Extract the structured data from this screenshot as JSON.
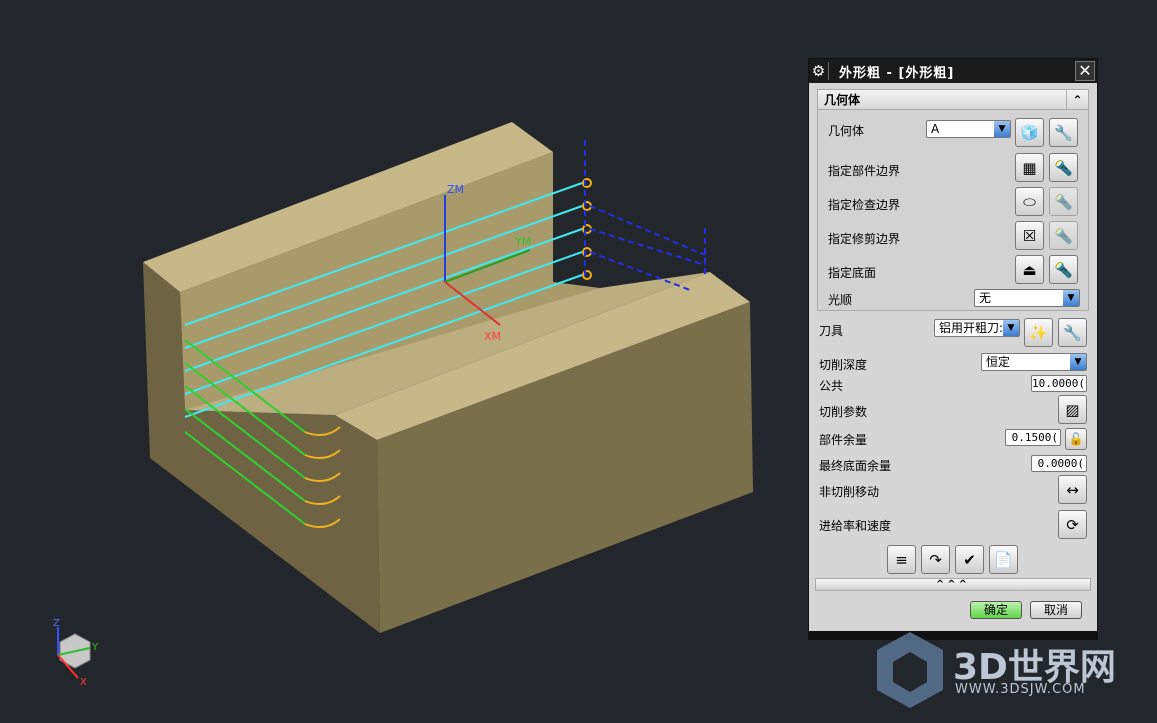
{
  "viewport": {
    "axis_labels": {
      "zm": "ZM",
      "ym": "YM",
      "xm": "XM"
    },
    "triad": {
      "z": "Z",
      "y": "Y",
      "x": "X"
    }
  },
  "dialog": {
    "title": "外形粗 - [外形粗]",
    "section_title": "几何体",
    "geometry": {
      "label": "几何体",
      "value": "A"
    },
    "part_boundary": "指定部件边界",
    "check_boundary": "指定检查边界",
    "trim_boundary": "指定修剪边界",
    "floor": "指定底面",
    "smooth": {
      "label": "光顺",
      "value": "无"
    },
    "tool": {
      "label": "刀具",
      "value": "铝用开粗刀:"
    },
    "cut_depth": {
      "label": "切削深度",
      "value": "恒定"
    },
    "common": {
      "label": "公共",
      "value": "10.0000("
    },
    "cut_params": "切削参数",
    "part_stock": {
      "label": "部件余量",
      "value": "0.1500("
    },
    "final_floor_stock": {
      "label": "最终底面余量",
      "value": "0.0000("
    },
    "non_cutting": "非切削移动",
    "feeds": "进给率和速度",
    "expand": "^^^",
    "ok": "确定",
    "cancel": "取消"
  },
  "watermark": {
    "name": "3D世界网",
    "url": "WWW.3DSJW.COM"
  }
}
